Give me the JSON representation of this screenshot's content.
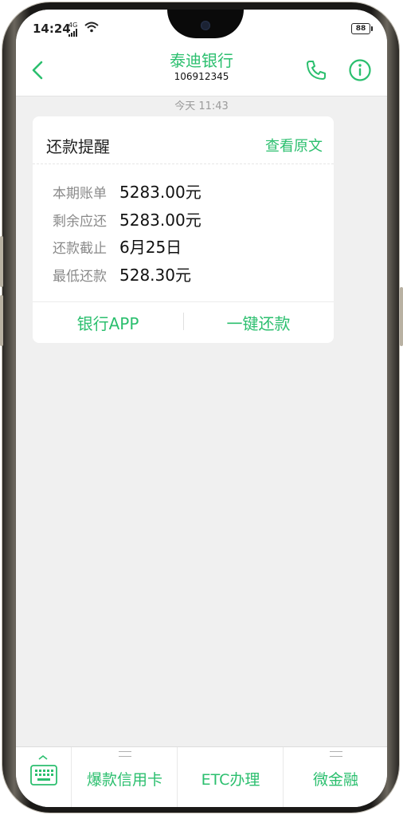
{
  "status_bar": {
    "time": "14:24",
    "signal": "4G",
    "battery": "88"
  },
  "header": {
    "title": "泰迪银行",
    "number": "106912345"
  },
  "timestamp": "今天 11:43",
  "message": {
    "title": "还款提醒",
    "view_original": "查看原文",
    "rows": [
      {
        "label": "本期账单",
        "value": "5283.00元"
      },
      {
        "label": "剩余应还",
        "value": "5283.00元"
      },
      {
        "label": "还款截止",
        "value": "6月25日"
      },
      {
        "label": "最低还款",
        "value": "528.30元"
      }
    ],
    "buttons": {
      "bank_app": "银行APP",
      "one_click_repay": "一键还款"
    }
  },
  "bottom_menu": [
    {
      "label": "爆款信用卡",
      "has_submenu": true
    },
    {
      "label": "ETC办理",
      "has_submenu": false
    },
    {
      "label": "微金融",
      "has_submenu": true
    }
  ],
  "colors": {
    "accent": "#2bbf6e",
    "background": "#f0f0f0"
  }
}
